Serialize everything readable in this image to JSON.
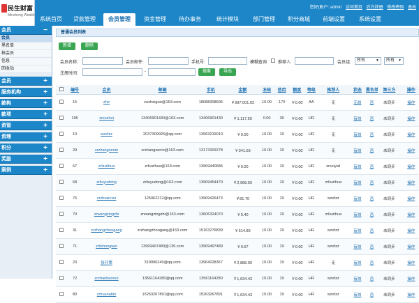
{
  "header": {
    "logo_title": "民生财富",
    "logo_sub": "Minsheng Wealth",
    "nav": [
      "系统首页",
      "贷款管理",
      "会员管理",
      "资金管理",
      "待办事务",
      "统计模块",
      "部门管理",
      "积分商城",
      "前端设置",
      "系统设置"
    ],
    "greeting": "您好(账户: admin",
    "links": [
      "访问首页",
      "后台註册",
      "修改密码",
      "退出"
    ]
  },
  "sidebar": {
    "head1": "会员",
    "subs": [
      "会员",
      "黑名单",
      "核会员",
      "信息",
      "回收站"
    ],
    "groups": [
      "会员",
      "服务机构",
      "款构",
      "款项",
      "资管",
      "资理",
      "积分",
      "奖励",
      "案例"
    ]
  },
  "main": {
    "panel_title": "普通会员列表",
    "btn_add": "新增",
    "btn_delete": "删除",
    "f_name": "会员名称:",
    "f_email": "会员邮件:",
    "f_phone": "手机号:",
    "f_fuzzy": "模糊查询",
    "f_referrer": "推荐人:",
    "f_group": "会员组:",
    "f_group_val": "所有",
    "f_type_val": "所有",
    "f_regtime": "注册时间:",
    "f_dash": "-",
    "btn_search": "搜索",
    "btn_export": "导出"
  },
  "table": {
    "headers": [
      "编号",
      "会员",
      "邮箱",
      "手机",
      "金额",
      "冻结",
      "信用",
      "额度",
      "等级",
      "推荐人",
      "状态",
      "黑名单",
      "第三方",
      "操作"
    ],
    "rows": [
      [
        "15",
        "zhe",
        "zuzhaiguo@163.com",
        "18088308695",
        "￥997,001.02",
        "10.00",
        "170",
        "￥0.00",
        "AA",
        "无",
        "无效",
        "否",
        "未同步",
        "操作"
      ],
      [
        "196",
        "zrxushui",
        "13406901430@163.com",
        "13406901430",
        "￥1,117.59",
        "0.00",
        "30",
        "￥0.00",
        "HR",
        "无",
        "有效",
        "否",
        "未同步",
        "操作"
      ],
      [
        "10",
        "wzxfzz",
        "2037309926@qq.com",
        "13963219010",
        "￥0.00",
        "10.00",
        "10",
        "￥0.00",
        "HR",
        "无",
        "有效",
        "否",
        "未同步",
        "操作"
      ],
      [
        "29",
        "zrzhangsenin",
        "zrzhangsenin@163.com",
        "13173309278",
        "￥341.59",
        "10.00",
        "10",
        "￥0.00",
        "HR",
        "无",
        "有效",
        "否",
        "未同步",
        "操作"
      ],
      [
        "67",
        "zrliuzihua",
        "zrliuzihua@163.com",
        "13969440686",
        "￥0.00",
        "10.00",
        "10",
        "￥0.00",
        "HR",
        "zrxeiyali",
        "有效",
        "否",
        "未同步",
        "操作"
      ],
      [
        "68",
        "zrliuyudong",
        "zrliuyudong@163.com",
        "13969454479",
        "￥2,968.56",
        "10.00",
        "10",
        "￥0.00",
        "HR",
        "zrliuzihua",
        "有效",
        "否",
        "未同步",
        "操作"
      ],
      [
        "76",
        "zrzhsaicxui",
        "125062212@qq.com",
        "13969426473",
        "￥81.70",
        "10.00",
        "10",
        "￥0.00",
        "HR",
        "wzxfzz",
        "有效",
        "否",
        "未同步",
        "操作"
      ],
      [
        "79",
        "zrwangzingzhi",
        "zrwangzingzhi@163.com",
        "13606324070",
        "￥0.40",
        "10.00",
        "10",
        "￥0.00",
        "HR",
        "zrliuzihua",
        "有效",
        "否",
        "未同步",
        "操作"
      ],
      [
        "31",
        "zrzhangzhougang",
        "zrzhangzhougang@163.com",
        "15163276839",
        "￥514.89",
        "10.00",
        "10",
        "￥0.00",
        "HR",
        "wzxfzz",
        "有效",
        "否",
        "未同步",
        "操作"
      ],
      [
        "71",
        "zrlishongwei",
        "13969497489@139.com",
        "13969497489",
        "￥0.67",
        "10.00",
        "10",
        "￥0.00",
        "HR",
        "wzxfzz",
        "有效",
        "否",
        "未同步",
        "操作"
      ],
      [
        "23",
        "张开策",
        "319990240@qq.com",
        "13964028367",
        "￥2,888.00",
        "10.00",
        "10",
        "￥0.00",
        "HR",
        "无",
        "有效",
        "否",
        "未同步",
        "操作"
      ],
      [
        "72",
        "zrzhanbaorun",
        "13561164280@qq.com",
        "13561164280",
        "￥1,634.43",
        "10.00",
        "10",
        "￥0.00",
        "HR",
        "wzxfzz",
        "有效",
        "否",
        "未同步",
        "操作"
      ],
      [
        "80",
        "zrhuanabin",
        "15263267891@qq.com",
        "15263267891",
        "￥1,634.43",
        "10.00",
        "10",
        "￥0.00",
        "HR",
        "wzxfzz",
        "有效",
        "否",
        "未同步",
        "操作"
      ]
    ]
  }
}
